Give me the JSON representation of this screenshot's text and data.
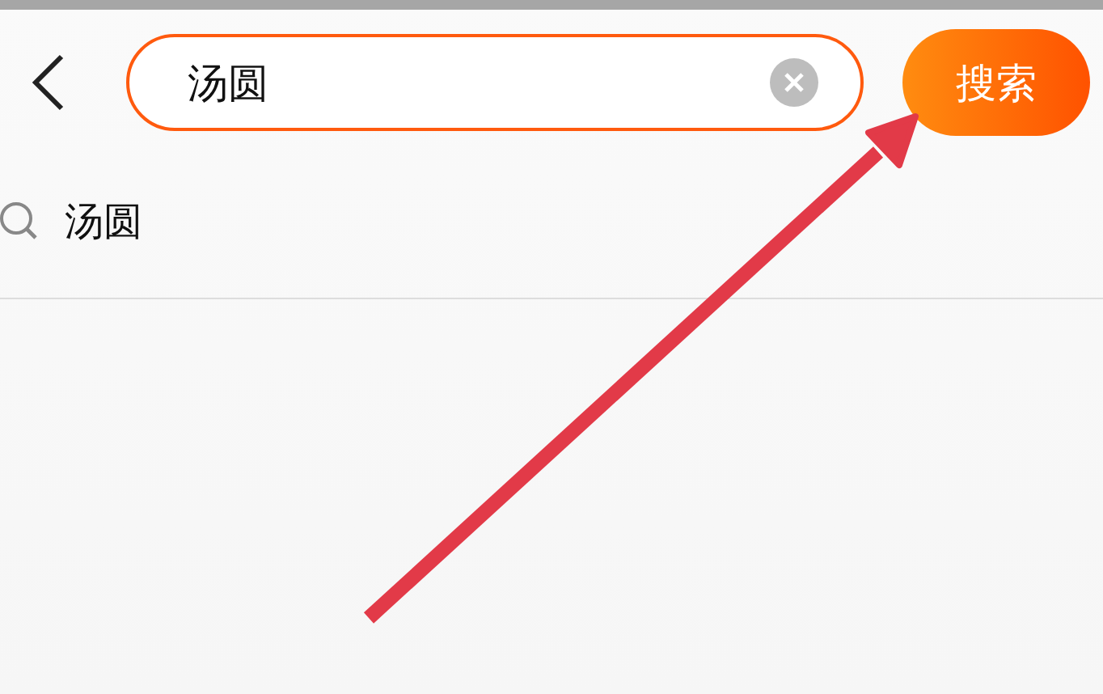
{
  "search": {
    "value": "汤圆",
    "button": "搜索"
  },
  "suggestions": [
    {
      "text": "汤圆"
    }
  ]
}
